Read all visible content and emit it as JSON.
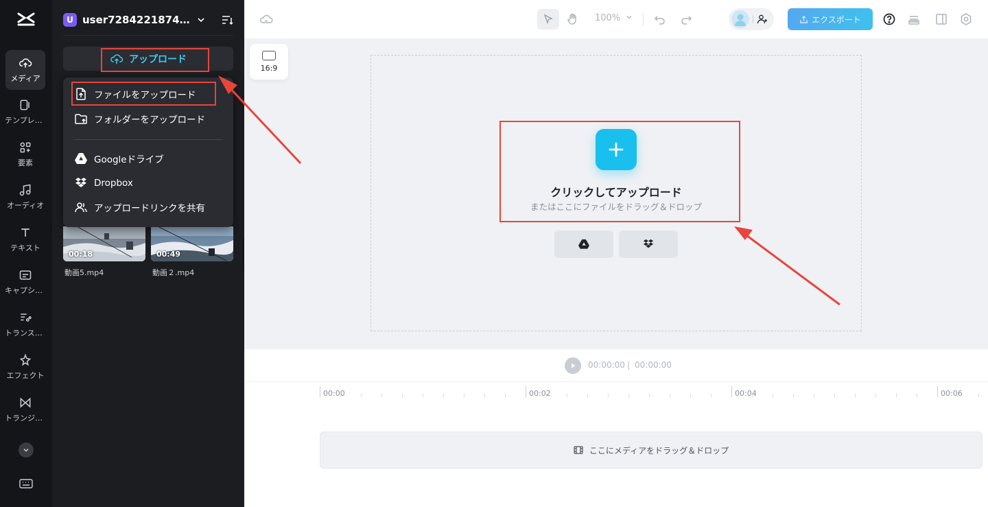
{
  "sidebar": {
    "items": [
      {
        "label": "メディア",
        "icon": "cloud-upload-icon"
      },
      {
        "label": "テンプレート",
        "icon": "template-icon"
      },
      {
        "label": "要素",
        "icon": "elements-icon"
      },
      {
        "label": "オーディオ",
        "icon": "music-note-icon"
      },
      {
        "label": "テキスト",
        "icon": "text-icon"
      },
      {
        "label": "キャプション",
        "icon": "caption-icon"
      },
      {
        "label": "トランスクリプト",
        "icon": "transcript-icon"
      },
      {
        "label": "エフェクト",
        "icon": "sparkle-icon"
      },
      {
        "label": "トランジション",
        "icon": "transition-icon"
      }
    ]
  },
  "panel": {
    "avatar_letter": "U",
    "username": "user7284221874131...",
    "upload_label": "アップロード",
    "menu": {
      "file_upload": "ファイルをアップロード",
      "folder_upload": "フォルダーをアップロード",
      "google_drive": "Googleドライブ",
      "dropbox": "Dropbox",
      "share_link": "アップロードリンクを共有"
    },
    "media": [
      {
        "duration": "00:18",
        "name": "動画5.mp4"
      },
      {
        "duration": "00:49",
        "name": "動画２.mp4"
      }
    ]
  },
  "toolbar": {
    "zoom": "100%",
    "export_label": "エクスポート"
  },
  "canvas": {
    "ratio": "16:9",
    "click_title": "クリックしてアップロード",
    "click_sub": "またはここにファイルをドラッグ＆ドロップ"
  },
  "timeline": {
    "current_time": "00:00:00",
    "separator": "|",
    "total_time": "00:00:00",
    "ticks": [
      "00:00",
      "00:02",
      "00:04",
      "00:06"
    ],
    "track_hint": "ここにメディアをドラッグ＆ドロップ"
  },
  "colors": {
    "accent": "#19c0ee",
    "annotation": "#e8453c",
    "rail_bg": "#141519",
    "panel_bg": "#1c1d21"
  }
}
